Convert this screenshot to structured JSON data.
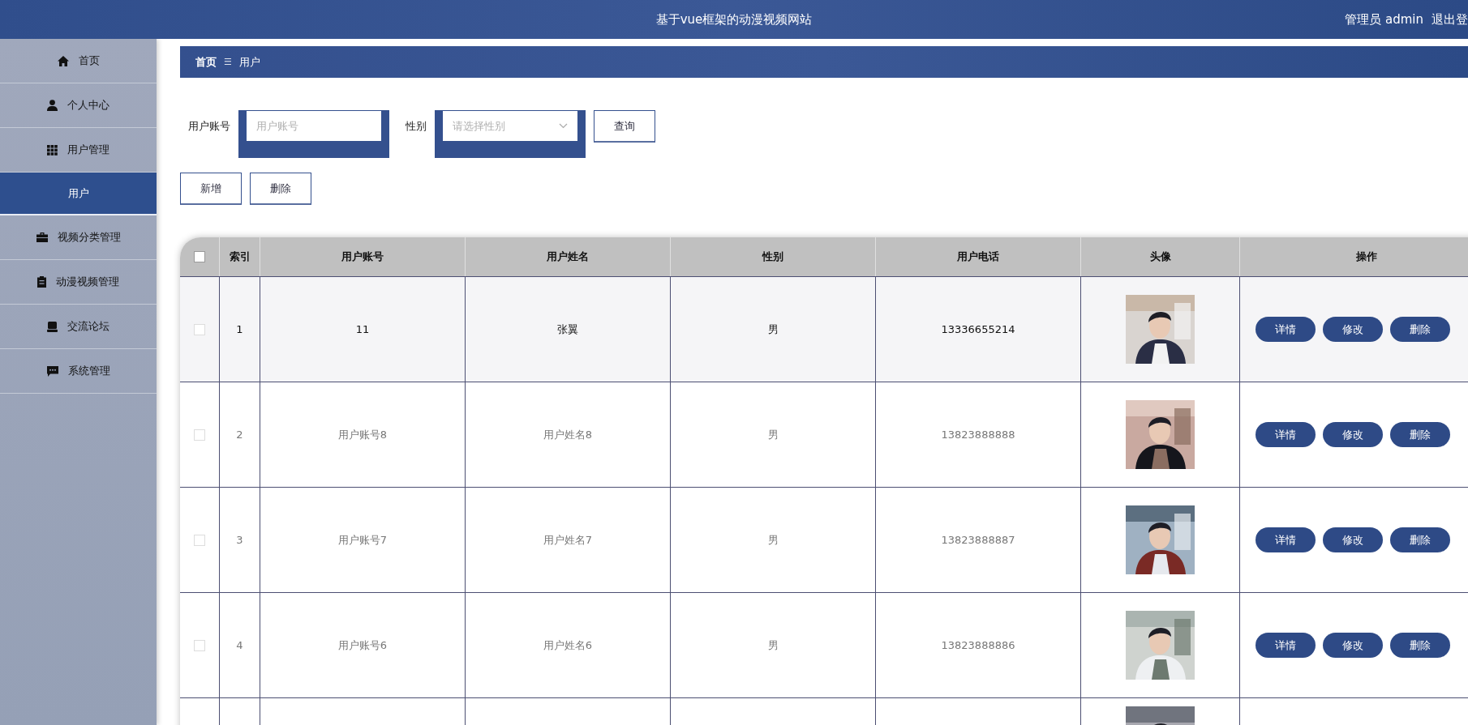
{
  "header": {
    "title": "基于vue框架的动漫视频网站",
    "user": "管理员 admin",
    "logout": "退出登"
  },
  "sidebar": {
    "items": [
      {
        "label": "首页",
        "kind": "home",
        "selected": false
      },
      {
        "label": "个人中心",
        "kind": "user",
        "selected": false
      },
      {
        "label": "用户管理",
        "kind": "grid",
        "selected": false,
        "expanded": true,
        "children": [
          {
            "label": "用户",
            "selected": true
          }
        ]
      },
      {
        "label": "视频分类管理",
        "kind": "briefcase",
        "selected": false
      },
      {
        "label": "动漫视频管理",
        "kind": "clipboard",
        "selected": false
      },
      {
        "label": "交流论坛",
        "kind": "tray",
        "selected": false
      },
      {
        "label": "系统管理",
        "kind": "chat",
        "selected": false
      }
    ]
  },
  "breadcrumb": {
    "items": [
      "首页",
      "用户"
    ],
    "separator": "☰"
  },
  "search": {
    "fields": [
      {
        "kind": "text",
        "label": "用户账号",
        "placeholder": "用户账号"
      },
      {
        "kind": "select",
        "label": "性别",
        "placeholder": "请选择性别"
      }
    ],
    "button": "查询"
  },
  "actions": [
    "新增",
    "删除"
  ],
  "table": {
    "columns": [
      "索引",
      "用户账号",
      "用户姓名",
      "性别",
      "用户电话",
      "头像",
      "操作"
    ],
    "header_checked": false,
    "rows": [
      {
        "kind": "full",
        "selected": false,
        "highlighted": true,
        "cells": [
          "1",
          "11",
          "张翼",
          "男",
          "13336655214"
        ],
        "actions": [
          "详情",
          "修改",
          "删除"
        ]
      },
      {
        "kind": "full",
        "selected": false,
        "highlighted": false,
        "cells": [
          "2",
          "用户账号8",
          "用户姓名8",
          "男",
          "13823888888"
        ],
        "actions": [
          "详情",
          "修改",
          "删除"
        ]
      },
      {
        "kind": "full",
        "selected": false,
        "highlighted": false,
        "cells": [
          "3",
          "用户账号7",
          "用户姓名7",
          "男",
          "13823888887"
        ],
        "actions": [
          "详情",
          "修改",
          "删除"
        ]
      },
      {
        "kind": "full",
        "selected": false,
        "highlighted": false,
        "cells": [
          "4",
          "用户账号6",
          "用户姓名6",
          "男",
          "13823888886"
        ],
        "actions": [
          "详情",
          "修改",
          "删除"
        ]
      },
      {
        "kind": "cut"
      }
    ]
  }
}
